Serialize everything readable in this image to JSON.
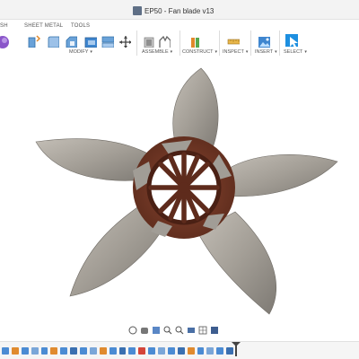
{
  "window": {
    "title": "EP50 - Fan blade v13"
  },
  "tabs": [
    "SH",
    "SHEET METAL",
    "TOOLS"
  ],
  "groups": {
    "modify": "MODIFY",
    "assemble": "ASSEMBLE",
    "construct": "CONSTRUCT",
    "inspect": "INSPECT",
    "insert": "INSERT",
    "select": "SELECT"
  },
  "colors": {
    "blade": "#a7a29b",
    "hub": "#6b3322",
    "select_blue": "#1d8fe0"
  },
  "icons": {
    "ribbon": [
      "extrude-icon",
      "shell-icon",
      "press-pull-icon",
      "fillet-icon",
      "chamfer-icon",
      "combine-icon",
      "scale-icon",
      "move-icon",
      "joint-icon",
      "as-built-joint-icon",
      "plane-icon",
      "axis-icon",
      "measure-icon",
      "insert-image-icon",
      "select-icon"
    ],
    "navigation": [
      "orbit-icon",
      "pan-icon",
      "look-at-icon",
      "zoom-icon",
      "fit-icon",
      "display-settings-icon",
      "grid-icon",
      "viewports-icon"
    ],
    "timeline": [
      "sketch-icon",
      "extrude-icon",
      "revolve-icon",
      "pattern-icon",
      "fillet-icon",
      "loft-icon",
      "mirror-icon",
      "combine-icon",
      "sketch-icon",
      "extrude-icon",
      "chamfer-icon",
      "split-icon",
      "move-icon",
      "shell-icon",
      "sketch-icon",
      "extrude-icon",
      "fillet-icon",
      "pattern-icon",
      "appearance-icon",
      "combine-icon",
      "extrude-icon",
      "sketch-icon",
      "revolve-icon",
      "fillet-icon"
    ]
  }
}
